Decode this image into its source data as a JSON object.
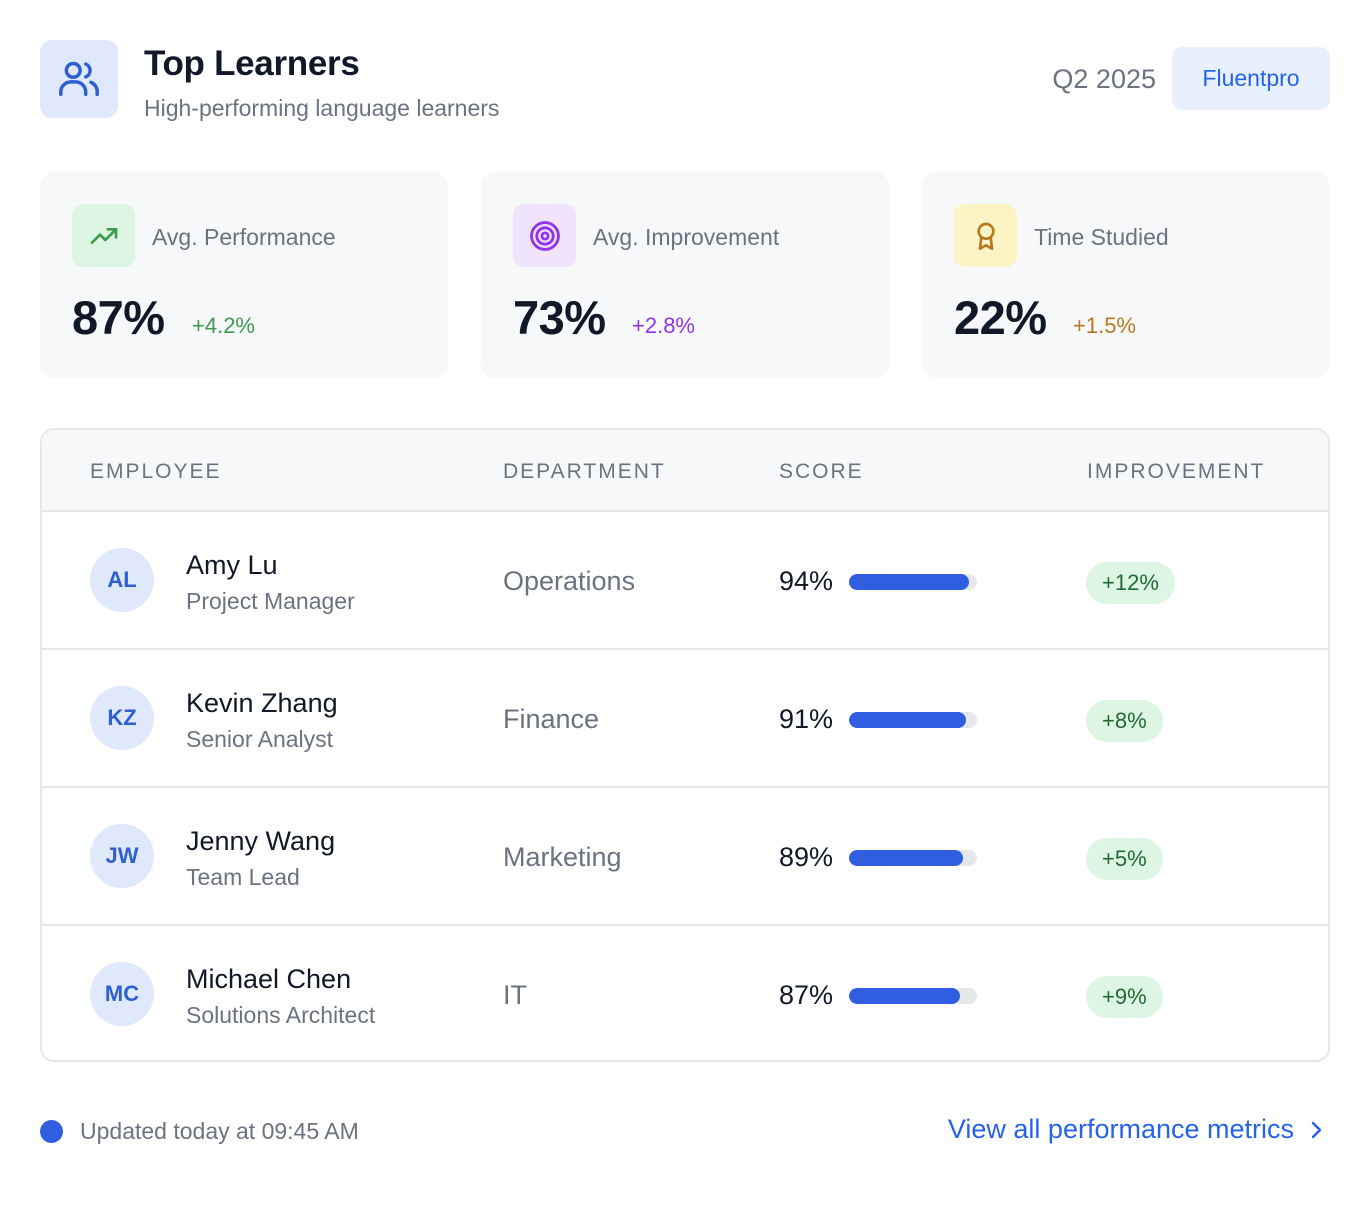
{
  "header": {
    "title": "Top Learners",
    "subtitle": "High-performing language learners",
    "period": "Q2 2025",
    "brand": "Fluentpro",
    "icon": "users-icon"
  },
  "stats": [
    {
      "label": "Avg. Performance",
      "value": "87%",
      "change": "+4.2%",
      "icon": "trending-up-icon",
      "color": "#3f9b4c",
      "bg": "#dcf6e3"
    },
    {
      "label": "Avg. Improvement",
      "value": "73%",
      "change": "+2.8%",
      "icon": "target-icon",
      "color": "#9333ea",
      "bg": "#efe4fc"
    },
    {
      "label": "Time Studied",
      "value": "22%",
      "change": "+1.5%",
      "icon": "award-icon",
      "color": "#b7791f",
      "bg": "#fcf4c4"
    }
  ],
  "table": {
    "headers": [
      "EMPLOYEE",
      "DEPARTMENT",
      "SCORE",
      "IMPROVEMENT"
    ],
    "rows": [
      {
        "initials": "AL",
        "name": "Amy Lu",
        "role": "Project Manager",
        "department": "Operations",
        "score": "94%",
        "score_value": 0.94,
        "improvement": "+12%"
      },
      {
        "initials": "KZ",
        "name": "Kevin Zhang",
        "role": "Senior Analyst",
        "department": "Finance",
        "score": "91%",
        "score_value": 0.91,
        "improvement": "+8%"
      },
      {
        "initials": "JW",
        "name": "Jenny Wang",
        "role": "Team Lead",
        "department": "Marketing",
        "score": "89%",
        "score_value": 0.89,
        "improvement": "+5%"
      },
      {
        "initials": "MC",
        "name": "Michael Chen",
        "role": "Solutions Architect",
        "department": "IT",
        "score": "87%",
        "score_value": 0.87,
        "improvement": "+9%"
      }
    ]
  },
  "footer": {
    "updated": "Updated today at 09:45 AM",
    "link": "View all performance metrics",
    "link_icon": "chevron-right-icon"
  },
  "colors": {
    "accent": "#2563eb",
    "bar": "#2f5fe0",
    "positive_bg": "#dcf6e3",
    "positive_text": "#1f6a35"
  }
}
